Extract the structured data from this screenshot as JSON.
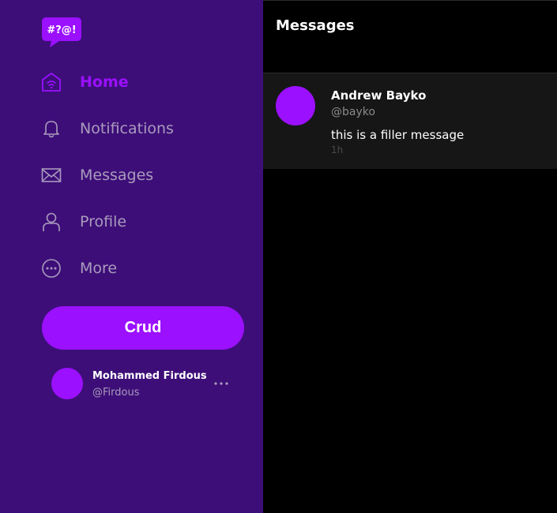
{
  "app": {
    "logo_text": "#?@!"
  },
  "sidebar": {
    "items": [
      {
        "label": "Home",
        "icon": "home-icon",
        "active": true
      },
      {
        "label": "Notifications",
        "icon": "bell-icon",
        "active": false
      },
      {
        "label": "Messages",
        "icon": "envelope-icon",
        "active": false
      },
      {
        "label": "Profile",
        "icon": "user-icon",
        "active": false
      },
      {
        "label": "More",
        "icon": "more-circle-icon",
        "active": false
      }
    ],
    "action_button_label": "Crud",
    "user": {
      "name": "Mohammed Firdous",
      "handle": "@Firdous",
      "more_icon": "ellipsis-icon"
    }
  },
  "main": {
    "title": "Messages",
    "messages": [
      {
        "name": "Andrew Bayko",
        "handle": "@bayko",
        "text": "this is a filler message",
        "time": "1h"
      }
    ]
  },
  "colors": {
    "sidebar_bg": "#3d0e78",
    "accent": "#9b10ff",
    "main_bg": "#000000",
    "card_bg": "#161616",
    "muted_text": "#a99bbd"
  }
}
